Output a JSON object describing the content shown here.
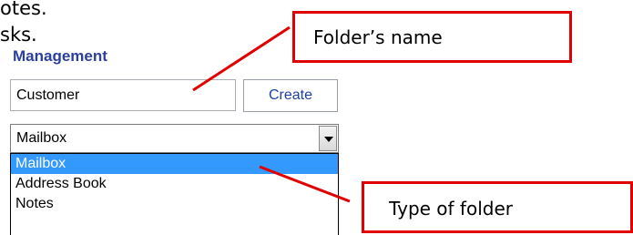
{
  "fragments": {
    "line1": "otes.",
    "line2": "sks."
  },
  "panel": {
    "title": "Management",
    "name_input": {
      "value": "Customer"
    },
    "create_button": {
      "label": "Create"
    },
    "folder_type_select": {
      "value": "Mailbox",
      "options": [
        "Mailbox",
        "Address Book",
        "Notes"
      ],
      "selected_index": 0
    }
  },
  "annotations": {
    "folder_name": "Folder’s name",
    "folder_type": "Type of folder"
  },
  "colors": {
    "callout_border": "#e00000",
    "pointer_line": "#e00000",
    "title_text": "#2a3f9e",
    "selected_option": "#3399ff"
  }
}
